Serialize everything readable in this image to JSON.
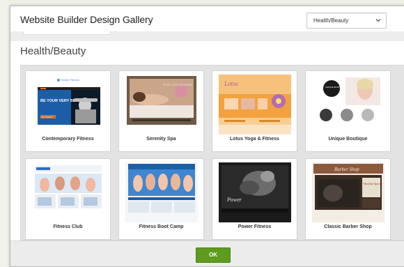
{
  "dialog": {
    "title": "Website Builder Design Gallery",
    "category_select": {
      "value": "Health/Beauty"
    },
    "section_title": "Health/Beauty",
    "ok_label": "OK"
  },
  "thumbnails": {
    "contemporary_fitness": {
      "logo": "Bolder Fitness",
      "headline": "BE YOUR VERY BEST",
      "cta": "Get Started"
    },
    "serenity_spa": {
      "heading": "Relax and rejuvenate"
    },
    "lotus_yoga": {
      "logo": "Lotus"
    },
    "unique_boutique": {
      "badge": "UNIQUE BOUTIQUE"
    },
    "power_fitness": {
      "heading": "Power"
    },
    "barber_shop": {
      "heading": "Barber Shop",
      "badge": "Monthly Special"
    }
  },
  "gallery": {
    "templates": [
      {
        "name": "Contemporary Fitness"
      },
      {
        "name": "Serenity Spa"
      },
      {
        "name": "Lotus Yoga & Fitness"
      },
      {
        "name": "Unique Boutique"
      },
      {
        "name": "Fitness Club"
      },
      {
        "name": "Fitness Boot Camp"
      },
      {
        "name": "Power Fitness"
      },
      {
        "name": "Classic Barber Shop"
      }
    ]
  },
  "colors": {
    "ok_button": "#5e9b1f",
    "fitness_blue": "#1f5fa8",
    "yoga_orange": "#f2a23e",
    "power_dark": "#2a2a2a",
    "barber_brown": "#8b5a3c"
  }
}
